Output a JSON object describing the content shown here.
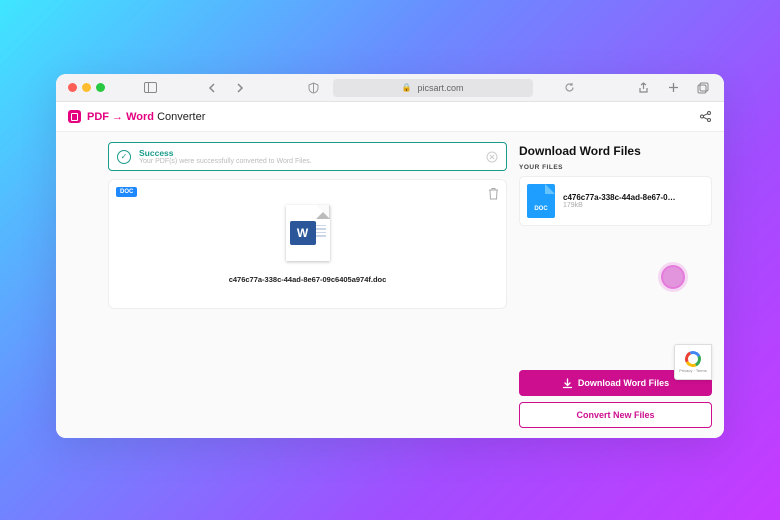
{
  "browser": {
    "url_host": "picsart.com",
    "traffic_colors": {
      "red": "#ff5f57",
      "yellow": "#febc2e",
      "green": "#28c840"
    }
  },
  "header": {
    "title_pink_1": "PDF",
    "title_arrow": " → ",
    "title_pink_2": "Word",
    "title_black": " Converter"
  },
  "success_banner": {
    "title": "Success",
    "subtitle": "Your PDF(s) were successfully converted to Word Files."
  },
  "preview": {
    "badge": "DOC",
    "word_mark": "W",
    "filename": "c476c77a-338c-44ad-8e67-09c6405a974f.doc"
  },
  "download_panel": {
    "heading": "Download Word Files",
    "your_files_label": "YOUR FILES",
    "file": {
      "doc_label": "DOC",
      "name": "c476c77a-338c-44ad-8e67-0…",
      "size": "179kB"
    },
    "download_button": "Download Word Files",
    "convert_button": "Convert New Files"
  },
  "recaptcha": {
    "line1": "Privacy · Terms"
  }
}
